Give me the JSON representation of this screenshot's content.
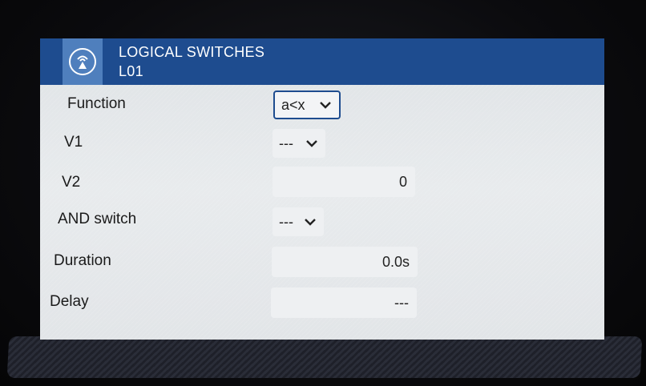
{
  "header": {
    "title": "LOGICAL SWITCHES",
    "subtitle": "L01",
    "icon": "radio-tower-icon",
    "color": "#1e4c8f",
    "icon_box_color": "#4f7fbd"
  },
  "rows": {
    "function": {
      "label": "Function",
      "value": "a<x"
    },
    "v1": {
      "label": "V1",
      "value": "---"
    },
    "v2": {
      "label": "V2",
      "value": "0"
    },
    "and_switch": {
      "label": "AND switch",
      "value": "---"
    },
    "duration": {
      "label": "Duration",
      "value": "0.0s"
    },
    "delay": {
      "label": "Delay",
      "value": "---"
    }
  }
}
